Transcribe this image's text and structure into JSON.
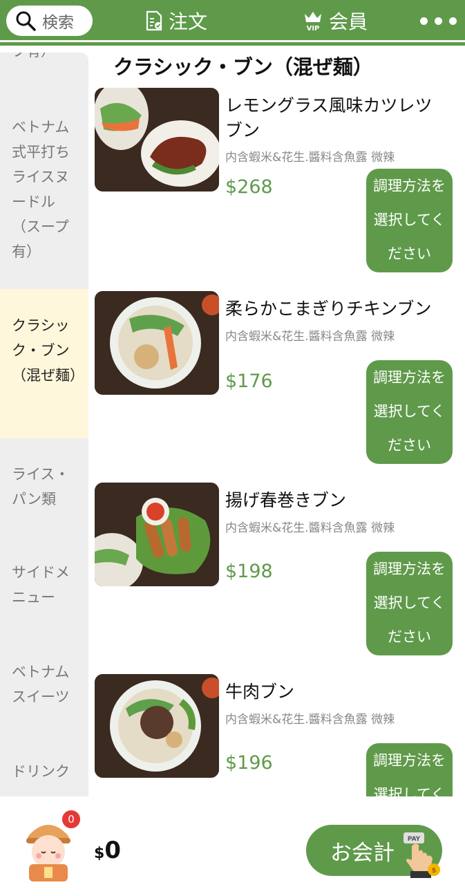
{
  "header": {
    "search_label": "検索",
    "order_label": "注文",
    "member_label": "会員",
    "vip_text": "VIP",
    "more_icon": "more-dots-icon"
  },
  "sidebar": {
    "items": [
      {
        "label": "プ有）"
      },
      {
        "label": "ベトナム式平打ちライスヌードル（スープ有）"
      },
      {
        "label": "クラシック・ブン（混ぜ麺）",
        "active": true
      },
      {
        "label": "ライス・パン類"
      },
      {
        "label": "サイドメニュー"
      },
      {
        "label": "ベトナムスイーツ"
      },
      {
        "label": "ドリンク"
      }
    ]
  },
  "main": {
    "section_title": "クラシック・ブン（混ぜ麺）",
    "items": [
      {
        "name": "レモングラス風味カツレツブン",
        "desc": "内含蝦米&花生.醬料含魚露 微辣",
        "price": "$268",
        "button": "調理方法を選択してください"
      },
      {
        "name": "柔らかこまぎりチキンブン",
        "desc": "内含蝦米&花生.醬料含魚露 微辣",
        "price": "$176",
        "button": "調理方法を選択してください"
      },
      {
        "name": "揚げ春巻きブン",
        "desc": "内含蝦米&花生.醬料含魚露 微辣",
        "price": "$198",
        "button": "調理方法を選択してください"
      },
      {
        "name": "牛肉ブン",
        "desc": "内含蝦米&花生.醬料含魚露 微辣",
        "price": "$196",
        "button": "調理方法を選択してください"
      }
    ]
  },
  "footer": {
    "cart_count": "0",
    "currency": "$",
    "total": "0",
    "checkout_label": "お会計",
    "pay_text": "PAY"
  },
  "colors": {
    "brand_green": "#5f9a4b",
    "active_sidebar": "#fff7dc",
    "badge_red": "#e53935"
  }
}
